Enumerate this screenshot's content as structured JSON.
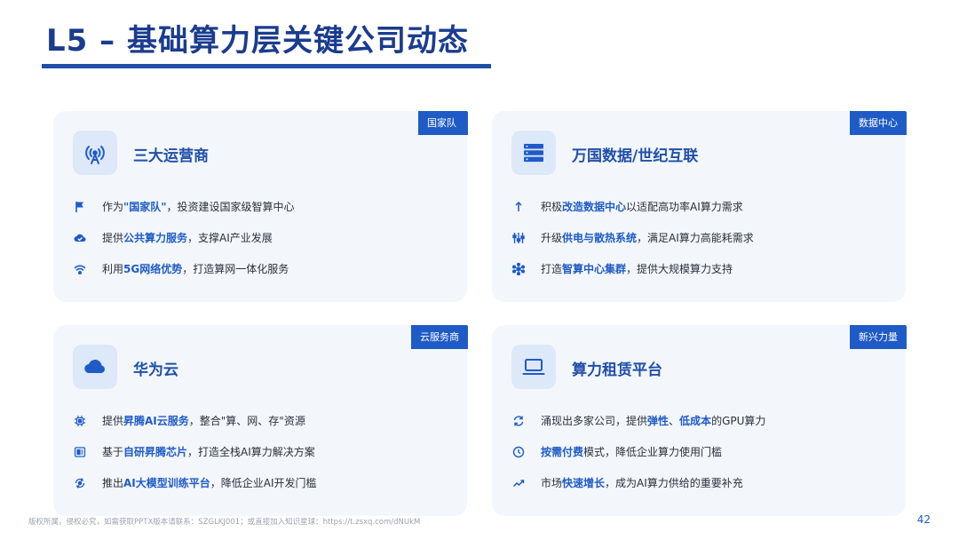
{
  "title": "L5 – 基础算力层关键公司动态",
  "cards": [
    {
      "tag": "国家队",
      "title": "三大运营商",
      "icon": "antenna-icon",
      "items": [
        {
          "icon": "flag-icon",
          "pre": "作为",
          "hl": "\"国家队\"",
          "post": "，投资建设国家级智算中心"
        },
        {
          "icon": "cloud-check-icon",
          "pre": "提供",
          "hl": "公共算力服务",
          "post": "，支撑AI产业发展"
        },
        {
          "icon": "wifi-icon",
          "pre": "利用",
          "hl": "5G网络优势",
          "post": "，打造算网一体化服务"
        }
      ]
    },
    {
      "tag": "数据中心",
      "title": "万国数据/世纪互联",
      "icon": "server-icon",
      "items": [
        {
          "icon": "arrow-up-icon",
          "pre": "积极",
          "hl": "改造数据中心",
          "post": "以适配高功率AI算力需求"
        },
        {
          "icon": "sliders-icon",
          "pre": "升级",
          "hl": "供电与散热系统",
          "post": "，满足AI算力高能耗需求"
        },
        {
          "icon": "cluster-icon",
          "pre": "打造",
          "hl": "智算中心集群",
          "post": "，提供大规模算力支持"
        }
      ]
    },
    {
      "tag": "云服务商",
      "title": "华为云",
      "icon": "cloud-icon",
      "items": [
        {
          "icon": "chip-icon",
          "pre": "提供",
          "hl": "昇腾AI云服务",
          "post": "，整合\"算、网、存\"资源"
        },
        {
          "icon": "board-icon",
          "pre": "基于",
          "hl": "自研昇腾芯片",
          "post": "，打造全栈AI算力解决方案"
        },
        {
          "icon": "brain-cycle-icon",
          "pre": "推出",
          "hl": "AI大模型训练平台",
          "post": "，降低企业AI开发门槛"
        }
      ]
    },
    {
      "tag": "新兴力量",
      "title": "算力租赁平台",
      "icon": "laptop-icon",
      "items": [
        {
          "icon": "refresh-icon",
          "pre": "涌现出多家公司，提供",
          "hl": "弹性",
          "mid": "、",
          "hl2": "低成本",
          "post": "的GPU算力"
        },
        {
          "icon": "clock-icon",
          "pre": "",
          "hl": "按需付费",
          "post": "模式，降低企业算力使用门槛"
        },
        {
          "icon": "trend-up-icon",
          "pre": "市场",
          "hl": "快速增长",
          "post": "，成为AI算力供给的重要补充"
        }
      ]
    }
  ],
  "footer": "版权所属，侵权必究，如需获取PPTX版本请联系：SZGLKJ001；或直接加入知识星球：https://t.zsxq.com/dNUkM",
  "page_number": "42",
  "colors": {
    "accent": "#1f5bc7",
    "title": "#1a3c8f",
    "card_bg": "#f3f7fc",
    "icon_bg": "#dde8f8"
  }
}
